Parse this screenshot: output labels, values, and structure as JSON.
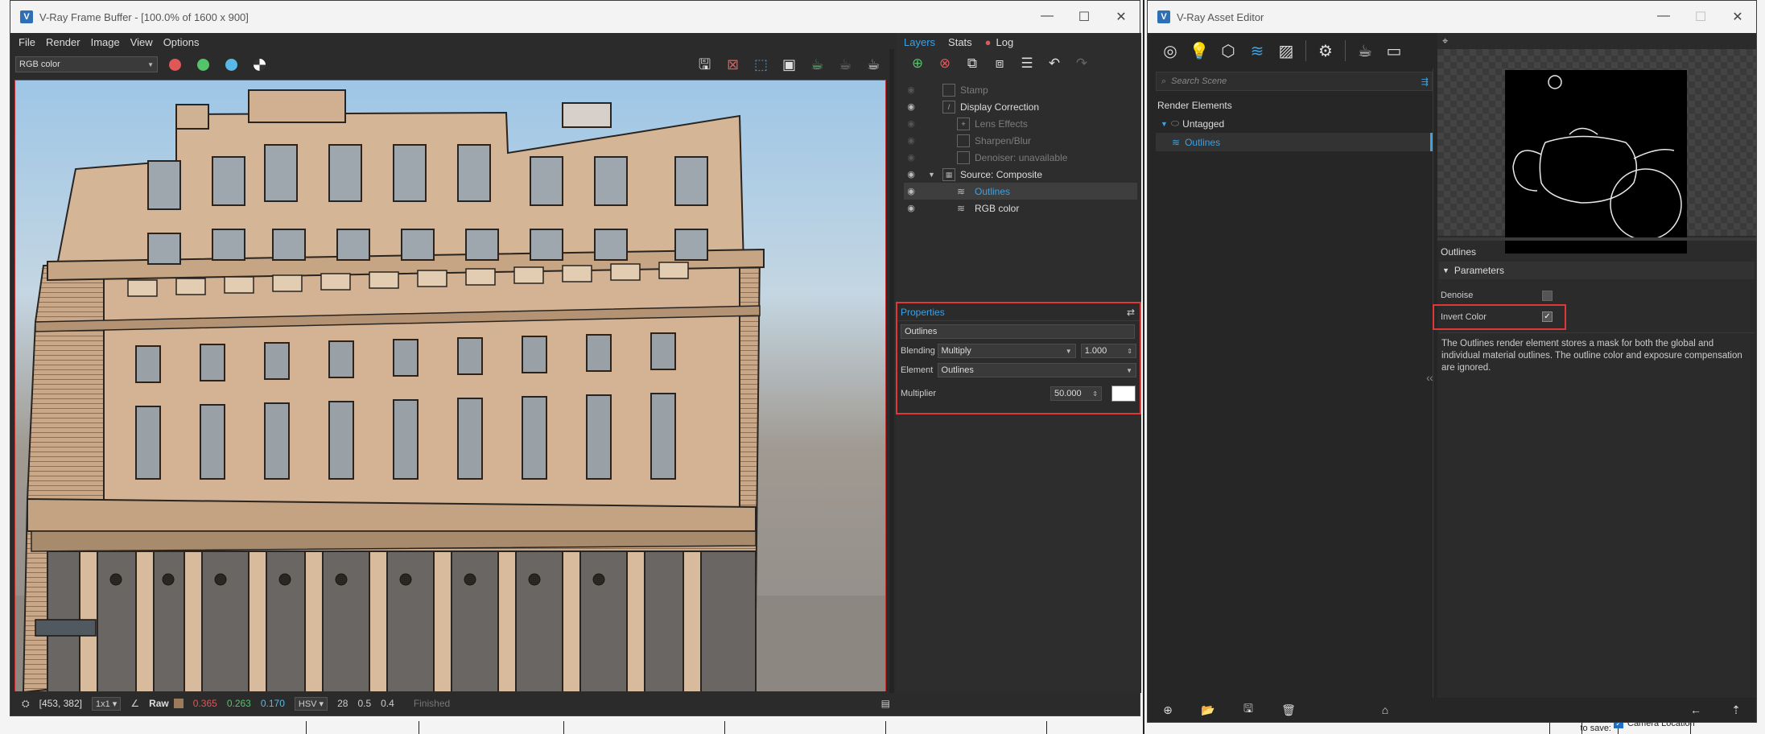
{
  "vfb": {
    "title": "V-Ray Frame Buffer - [100.0% of 1600 x 900]",
    "menu": [
      "File",
      "Render",
      "Image",
      "View",
      "Options"
    ],
    "channel": "RGB color",
    "status": {
      "coords": "[453, 382]",
      "zoom": "1x1",
      "mode": "Raw",
      "r": "0.365",
      "g": "0.263",
      "b": "0.170",
      "colorspace": "HSV",
      "h": "28",
      "s": "0.5",
      "v": "0.4",
      "state": "Finished"
    }
  },
  "layers": {
    "tabs": [
      "Layers",
      "Stats",
      "Log"
    ],
    "items": [
      {
        "label": "Stamp",
        "enabled": false
      },
      {
        "label": "Display Correction",
        "enabled": true
      },
      {
        "label": "Lens Effects",
        "enabled": false
      },
      {
        "label": "Sharpen/Blur",
        "enabled": false
      },
      {
        "label": "Denoiser: unavailable",
        "enabled": false
      },
      {
        "label": "Source: Composite",
        "enabled": true
      },
      {
        "label": "Outlines",
        "enabled": true
      },
      {
        "label": "RGB color",
        "enabled": true
      }
    ]
  },
  "properties": {
    "title": "Properties",
    "name": "Outlines",
    "blending_label": "Blending",
    "blending_value": "Multiply",
    "opacity": "1.000",
    "element_label": "Element",
    "element_value": "Outlines",
    "multiplier_label": "Multiplier",
    "multiplier_value": "50.000",
    "swatch_color": "#ffffff"
  },
  "asset_editor": {
    "title": "V-Ray Asset Editor",
    "search_placeholder": "Search Scene",
    "tree": {
      "root": "Render Elements",
      "group": "Untagged",
      "item": "Outlines"
    },
    "panel_title": "Outlines",
    "section": "Parameters",
    "denoise_label": "Denoise",
    "denoise_checked": false,
    "invert_label": "Invert Color",
    "invert_checked": true,
    "description": "The Outlines render element stores a mask for both the global and individual material outlines. The outline color and exposure compensation are ignored."
  },
  "background_app": {
    "properties_label": "Properties to save:",
    "camera_label": "Camera Location"
  },
  "colors": {
    "accent": "#3da1e3",
    "highlight": "#e03838",
    "red": "#e05757",
    "green": "#53c46a",
    "blue": "#58b8e8"
  }
}
